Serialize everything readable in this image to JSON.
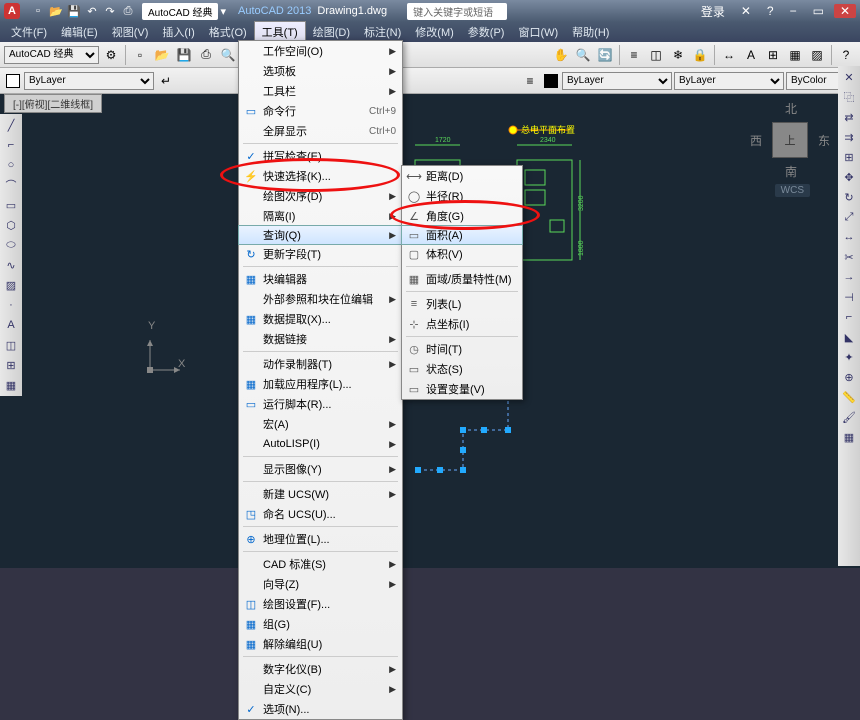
{
  "title": {
    "app": "AutoCAD 2013",
    "file": "Drawing1.dwg",
    "doc_tab": "AutoCAD 经典",
    "search_placeholder": "键入关键字或短语",
    "login": "登录"
  },
  "menubar": [
    "文件(F)",
    "编辑(E)",
    "视图(V)",
    "插入(I)",
    "格式(O)",
    "工具(T)",
    "绘图(D)",
    "标注(N)",
    "修改(M)",
    "参数(P)",
    "窗口(W)",
    "帮助(H)"
  ],
  "active_menu_index": 5,
  "workspace_selector": "AutoCAD 经典",
  "layer_selector": "ByLayer",
  "linetype_selector": "ByLayer",
  "viewport_tab": "[-][俯视][二维线框]",
  "viewcube": {
    "n": "北",
    "s": "南",
    "e": "东",
    "w": "西",
    "top": "上"
  },
  "wcs_label": "WCS",
  "axis": {
    "x": "X",
    "y": "Y"
  },
  "dropdown": [
    {
      "label": "工作空间(O)",
      "arrow": true
    },
    {
      "label": "选项板",
      "arrow": true
    },
    {
      "label": "工具栏",
      "arrow": true
    },
    {
      "label": "命令行",
      "kb": "Ctrl+9",
      "ico": "▭"
    },
    {
      "label": "全屏显示",
      "kb": "Ctrl+0"
    },
    {
      "sep": true
    },
    {
      "label": "拼写检查(E)",
      "ico": "✓"
    },
    {
      "label": "快速选择(K)...",
      "ico": "⚡"
    },
    {
      "label": "绘图次序(D)",
      "arrow": true
    },
    {
      "label": "隔离(I)",
      "arrow": true
    },
    {
      "label": "查询(Q)",
      "arrow": true,
      "hover": true
    },
    {
      "label": "更新字段(T)",
      "ico": "↻"
    },
    {
      "sep": true
    },
    {
      "label": "块编辑器",
      "ico": "▦"
    },
    {
      "label": "外部参照和块在位编辑",
      "arrow": true
    },
    {
      "label": "数据提取(X)...",
      "ico": "▦"
    },
    {
      "label": "数据链接",
      "arrow": true
    },
    {
      "sep": true
    },
    {
      "label": "动作录制器(T)",
      "arrow": true
    },
    {
      "label": "加载应用程序(L)...",
      "ico": "▦"
    },
    {
      "label": "运行脚本(R)...",
      "ico": "▭"
    },
    {
      "label": "宏(A)",
      "arrow": true
    },
    {
      "label": "AutoLISP(I)",
      "arrow": true
    },
    {
      "sep": true
    },
    {
      "label": "显示图像(Y)",
      "arrow": true
    },
    {
      "sep": true
    },
    {
      "label": "新建 UCS(W)",
      "arrow": true
    },
    {
      "label": "命名 UCS(U)...",
      "ico": "◳"
    },
    {
      "sep": true
    },
    {
      "label": "地理位置(L)...",
      "ico": "⊕"
    },
    {
      "sep": true
    },
    {
      "label": "CAD 标准(S)",
      "arrow": true
    },
    {
      "label": "向导(Z)",
      "arrow": true
    },
    {
      "label": "绘图设置(F)...",
      "ico": "◫"
    },
    {
      "label": "组(G)",
      "ico": "▦"
    },
    {
      "label": "解除编组(U)",
      "ico": "▦"
    },
    {
      "sep": true
    },
    {
      "label": "数字化仪(B)",
      "arrow": true
    },
    {
      "label": "自定义(C)",
      "arrow": true
    },
    {
      "label": "选项(N)...",
      "ico": "✓"
    }
  ],
  "submenu": [
    {
      "label": "距离(D)",
      "ico": "⟷"
    },
    {
      "label": "半径(R)",
      "ico": "◯"
    },
    {
      "label": "角度(G)",
      "ico": "∠"
    },
    {
      "label": "面积(A)",
      "ico": "▭",
      "hover": true
    },
    {
      "label": "体积(V)",
      "ico": "▢"
    },
    {
      "sep": true
    },
    {
      "label": "面域/质量特性(M)",
      "ico": "▦"
    },
    {
      "sep": true
    },
    {
      "label": "列表(L)",
      "ico": "≡"
    },
    {
      "label": "点坐标(I)",
      "ico": "⊹"
    },
    {
      "sep": true
    },
    {
      "label": "时间(T)",
      "ico": "◷"
    },
    {
      "label": "状态(S)",
      "ico": "▭"
    },
    {
      "label": "设置变量(V)",
      "ico": "▭"
    }
  ],
  "drawing_text": "总电平面布置",
  "colors": {
    "accent": "#5ad85a",
    "highlight": "#e31111",
    "grip": "#22aaff"
  }
}
